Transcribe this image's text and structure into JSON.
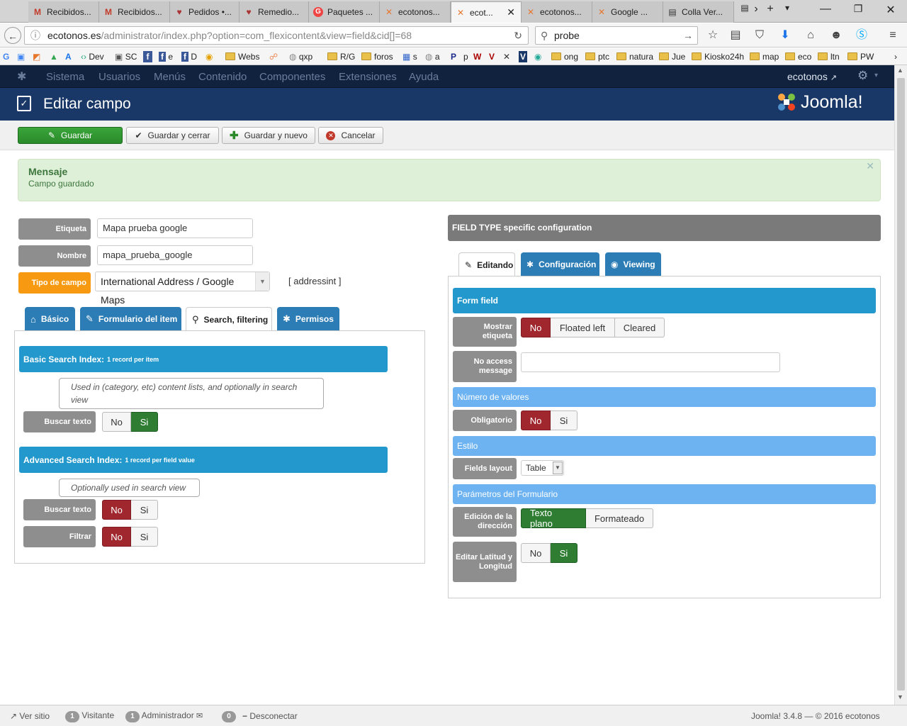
{
  "browser": {
    "tabs": [
      {
        "icon": "M",
        "label": "Recibidos..."
      },
      {
        "icon": "M",
        "label": "Recibidos..."
      },
      {
        "icon": "♥",
        "label": "Pedidos •..."
      },
      {
        "icon": "♥",
        "label": "Remedio..."
      },
      {
        "icon": "G",
        "label": "Paquetes ..."
      },
      {
        "icon": "✕",
        "label": "ecotonos..."
      },
      {
        "icon": "✕",
        "label": "ecot..."
      },
      {
        "icon": "✕",
        "label": "ecotonos..."
      },
      {
        "icon": "✕",
        "label": "Google ..."
      },
      {
        "icon": "▤",
        "label": "Colla Ver..."
      }
    ],
    "url_host": "ecotonos.es",
    "url_path": "/administrator/index.php?option=com_flexicontent&view=field&cid[]=68",
    "search_value": "probe",
    "bookmarks": [
      "Dev",
      "SC",
      "e",
      "D",
      "Webs",
      "qxp",
      "R/G",
      "foros",
      "s",
      "a",
      "P",
      "p",
      "ong",
      "ptc",
      "natura",
      "Jue",
      "Kiosko24h",
      "map",
      "eco",
      "ltn",
      "PW"
    ]
  },
  "joomla": {
    "menu": [
      "Sistema",
      "Usuarios",
      "Menús",
      "Contenido",
      "Componentes",
      "Extensiones",
      "Ayuda"
    ],
    "user": "ecotonos",
    "page_title": "Editar campo",
    "logo_text": "Joomla!",
    "toolbar": {
      "save": "Guardar",
      "save_close": "Guardar y cerrar",
      "save_new": "Guardar y nuevo",
      "cancel": "Cancelar"
    },
    "alert": {
      "title": "Mensaje",
      "text": "Campo guardado"
    }
  },
  "form": {
    "etiqueta_label": "Etiqueta",
    "etiqueta_value": "Mapa prueba google",
    "nombre_label": "Nombre",
    "nombre_value": "mapa_prueba_google",
    "tipo_label": "Tipo de campo",
    "tipo_value": "International Address / Google Maps",
    "tipo_code": "[ addressint ]",
    "left_tabs": [
      "Básico",
      "Formulario del item",
      "Search, filtering",
      "Permisos"
    ],
    "basic_title": "Basic Search Index:",
    "basic_note": "1 record per item",
    "basic_help": "Used in (category, etc) content lists, and optionally in search view",
    "buscar_texto": "Buscar texto",
    "no": "No",
    "si": "Si",
    "adv_title": "Advanced Search Index:",
    "adv_note": "1 record per field value",
    "adv_help": "Optionally used in search view",
    "filtrar": "Filtrar"
  },
  "right": {
    "header": "FIELD TYPE specific configuration",
    "tabs": [
      "Editando",
      "Configuración",
      "Viewing"
    ],
    "form_field": "Form field",
    "mostrar_etiqueta": "Mostrar etiqueta",
    "floated_left": "Floated left",
    "cleared": "Cleared",
    "no_access": "No access message",
    "numero_valores": "Número de valores",
    "obligatorio": "Obligatorio",
    "estilo": "Estilo",
    "fields_layout": "Fields layout",
    "fields_layout_value": "Table",
    "parametros": "Parámetros del Formulario",
    "edicion": "Edición de la dirección",
    "texto_plano": "Texto plano",
    "formateado": "Formateado",
    "editar_lat": "Editar Latitud y Longitud"
  },
  "status": {
    "ver_sitio": "Ver sitio",
    "visitante_count": "1",
    "visitante": "Visitante",
    "admin_count": "1",
    "administrador": "Administrador",
    "msg_count": "0",
    "desconectar": "Desconectar",
    "version": "Joomla! 3.4.8",
    "copyright": "— © 2016 ecotonos"
  }
}
